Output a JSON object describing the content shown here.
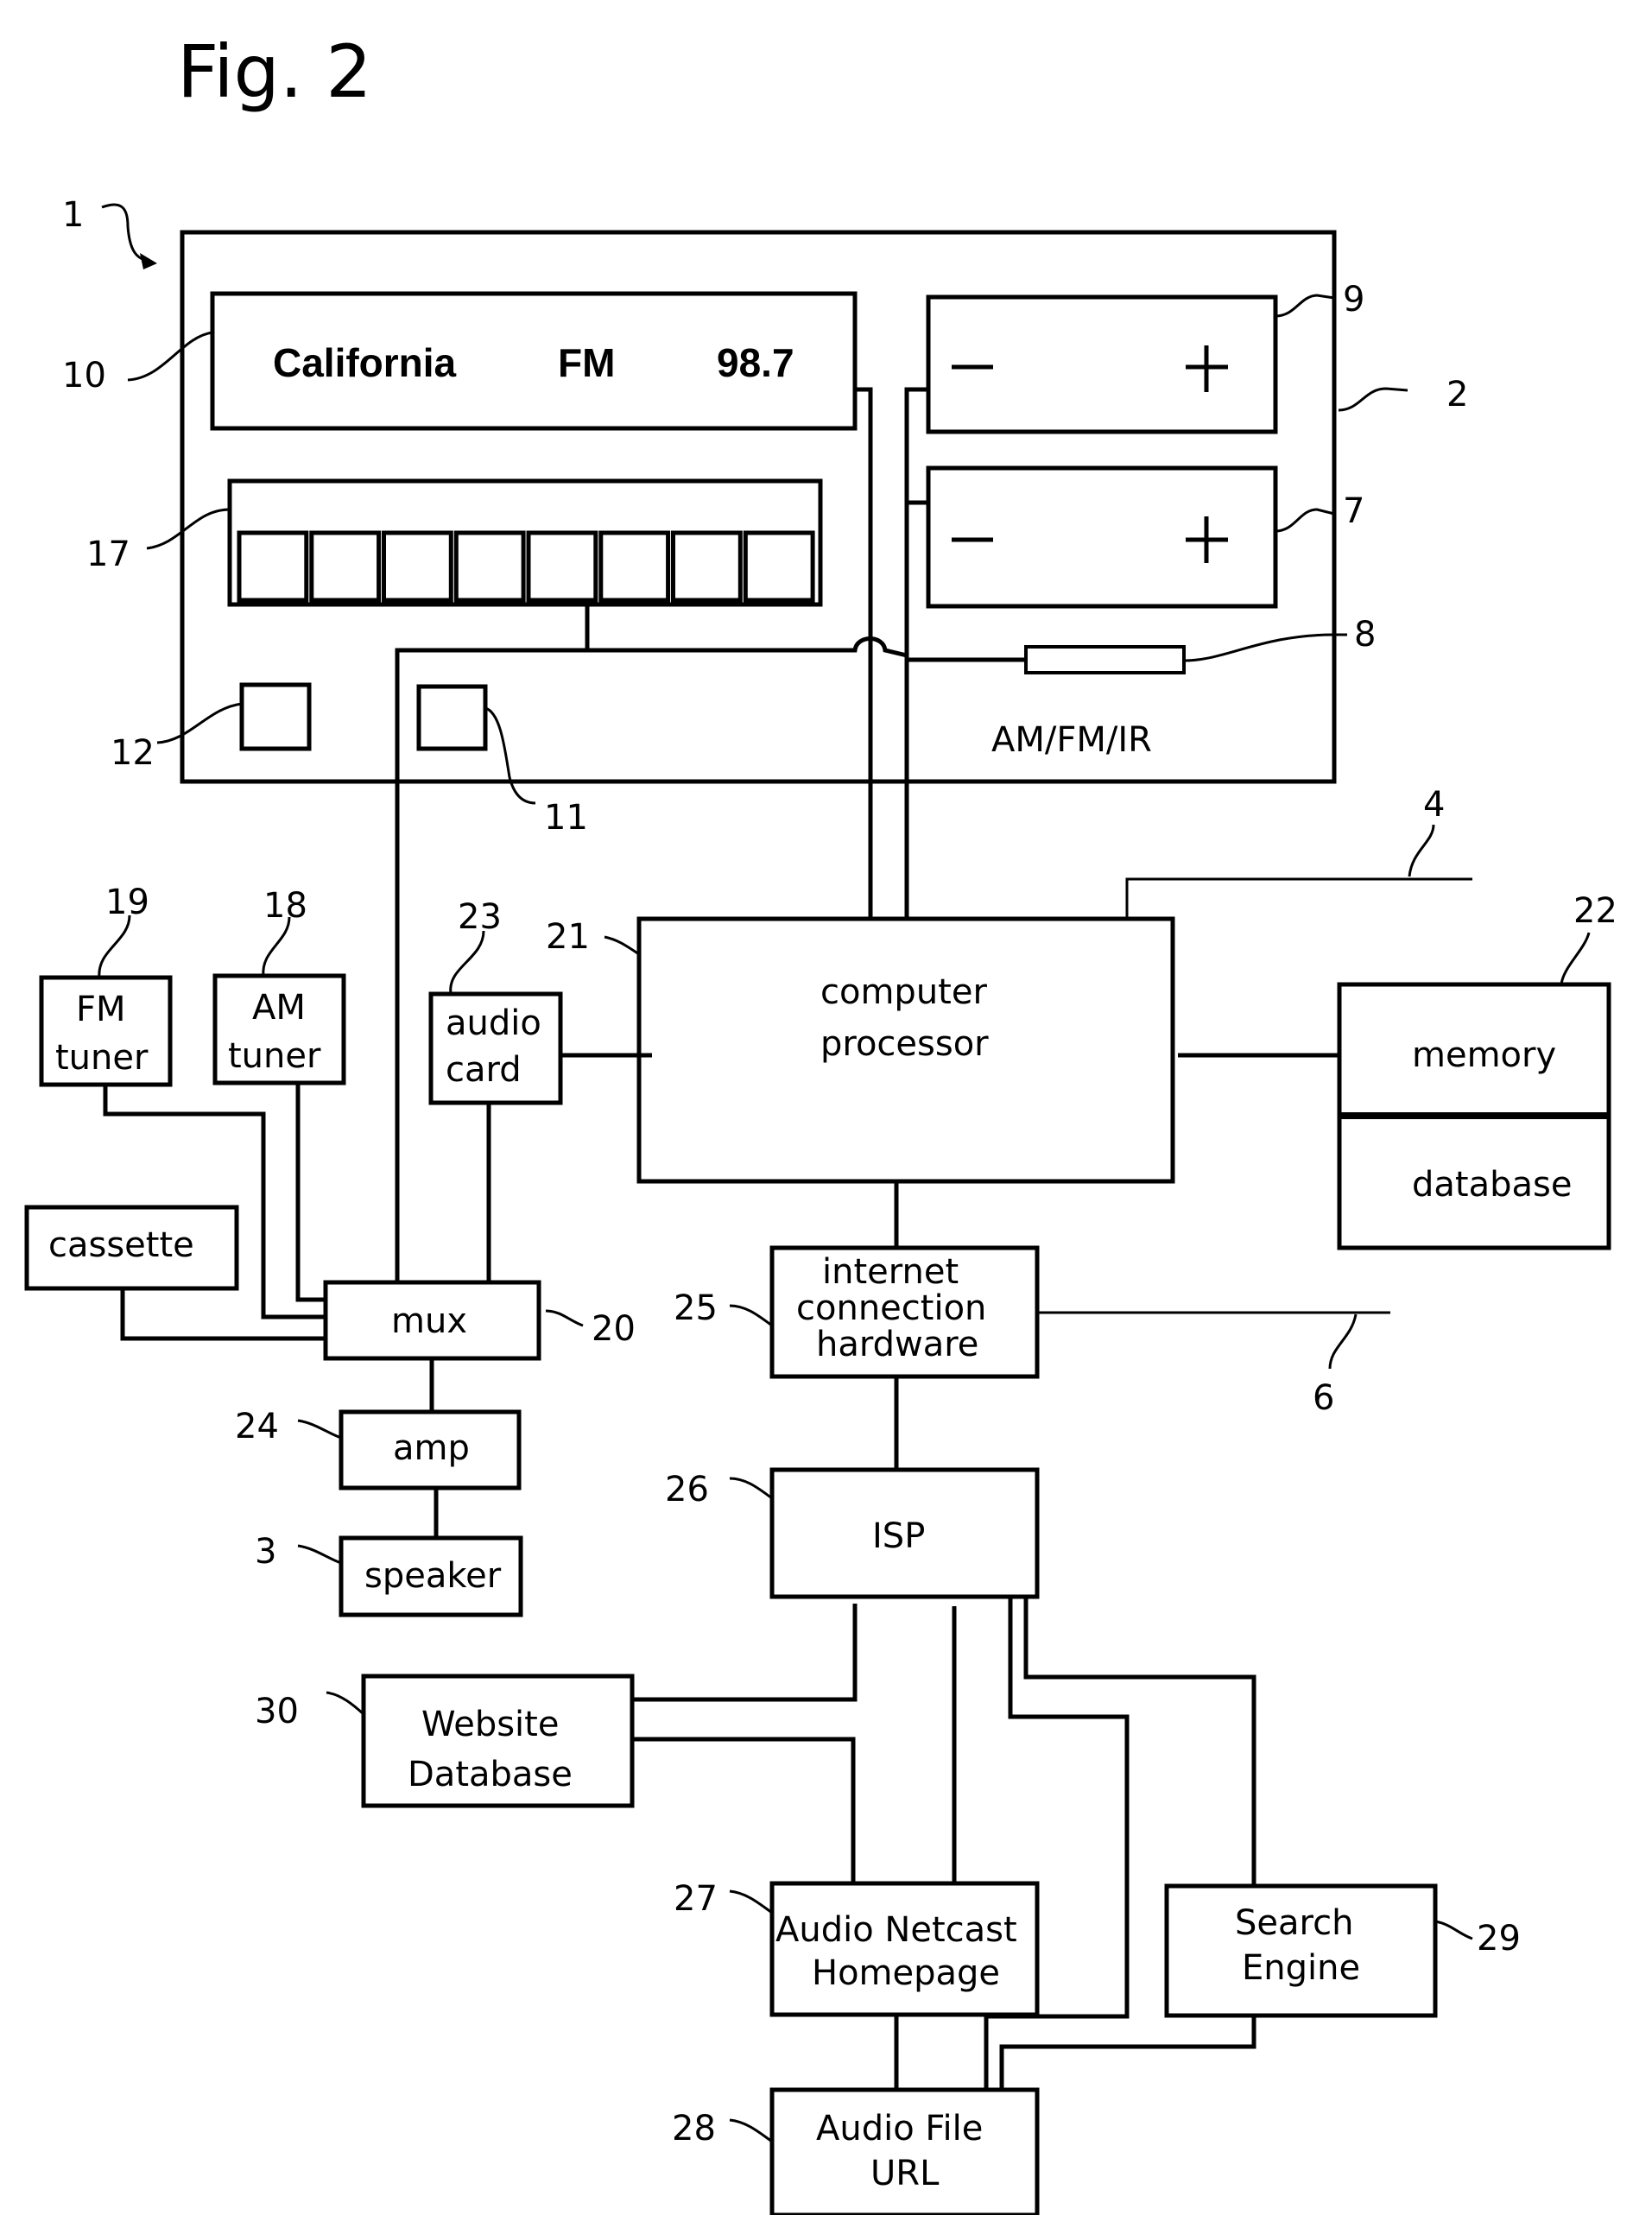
{
  "figure": {
    "title": "Fig. 2"
  },
  "radio_unit": {
    "ref": "1",
    "housing_ref": "2",
    "display": {
      "ref": "10",
      "station": "California",
      "band": "FM",
      "frequency": "98.7"
    },
    "control_9": {
      "ref": "9",
      "minus": "—",
      "plus": "+"
    },
    "control_7": {
      "ref": "7",
      "minus": "—",
      "plus": "+"
    },
    "slot_8": {
      "ref": "8"
    },
    "mode_label": "AM/FM/IR",
    "presets": {
      "ref": "17",
      "count": 8
    },
    "button_12": {
      "ref": "12"
    },
    "button_11": {
      "ref": "11"
    }
  },
  "blocks": {
    "fm_tuner": {
      "ref": "19",
      "line1": "FM",
      "line2": "tuner"
    },
    "am_tuner": {
      "ref": "18",
      "line1": "AM",
      "line2": "tuner"
    },
    "audio_card": {
      "ref": "23",
      "line1": "audio",
      "line2": "card"
    },
    "computer_processor": {
      "ref": "21",
      "line1": "computer",
      "line2": "processor"
    },
    "memory_db": {
      "ref": "22",
      "top": "memory",
      "bottom": "database"
    },
    "cassette": {
      "label": "cassette"
    },
    "mux": {
      "ref": "20",
      "label": "mux"
    },
    "amp": {
      "ref": "24",
      "label": "amp"
    },
    "speaker": {
      "ref": "3",
      "label": "speaker"
    },
    "internet_hw": {
      "ref": "25",
      "line1": "internet",
      "line2": "connection",
      "line3": "hardware"
    },
    "isp": {
      "ref": "26",
      "label": "ISP"
    },
    "website_db": {
      "ref": "30",
      "line1": "Website",
      "line2": "Database"
    },
    "netcast_home": {
      "ref": "27",
      "line1": "Audio Netcast",
      "line2": "Homepage"
    },
    "search_engine": {
      "ref": "29",
      "line1": "Search",
      "line2": "Engine"
    },
    "audio_file_url": {
      "ref": "28",
      "line1": "Audio File",
      "line2": "URL"
    }
  },
  "links": {
    "link_4": {
      "ref": "4"
    },
    "link_6": {
      "ref": "6"
    }
  }
}
